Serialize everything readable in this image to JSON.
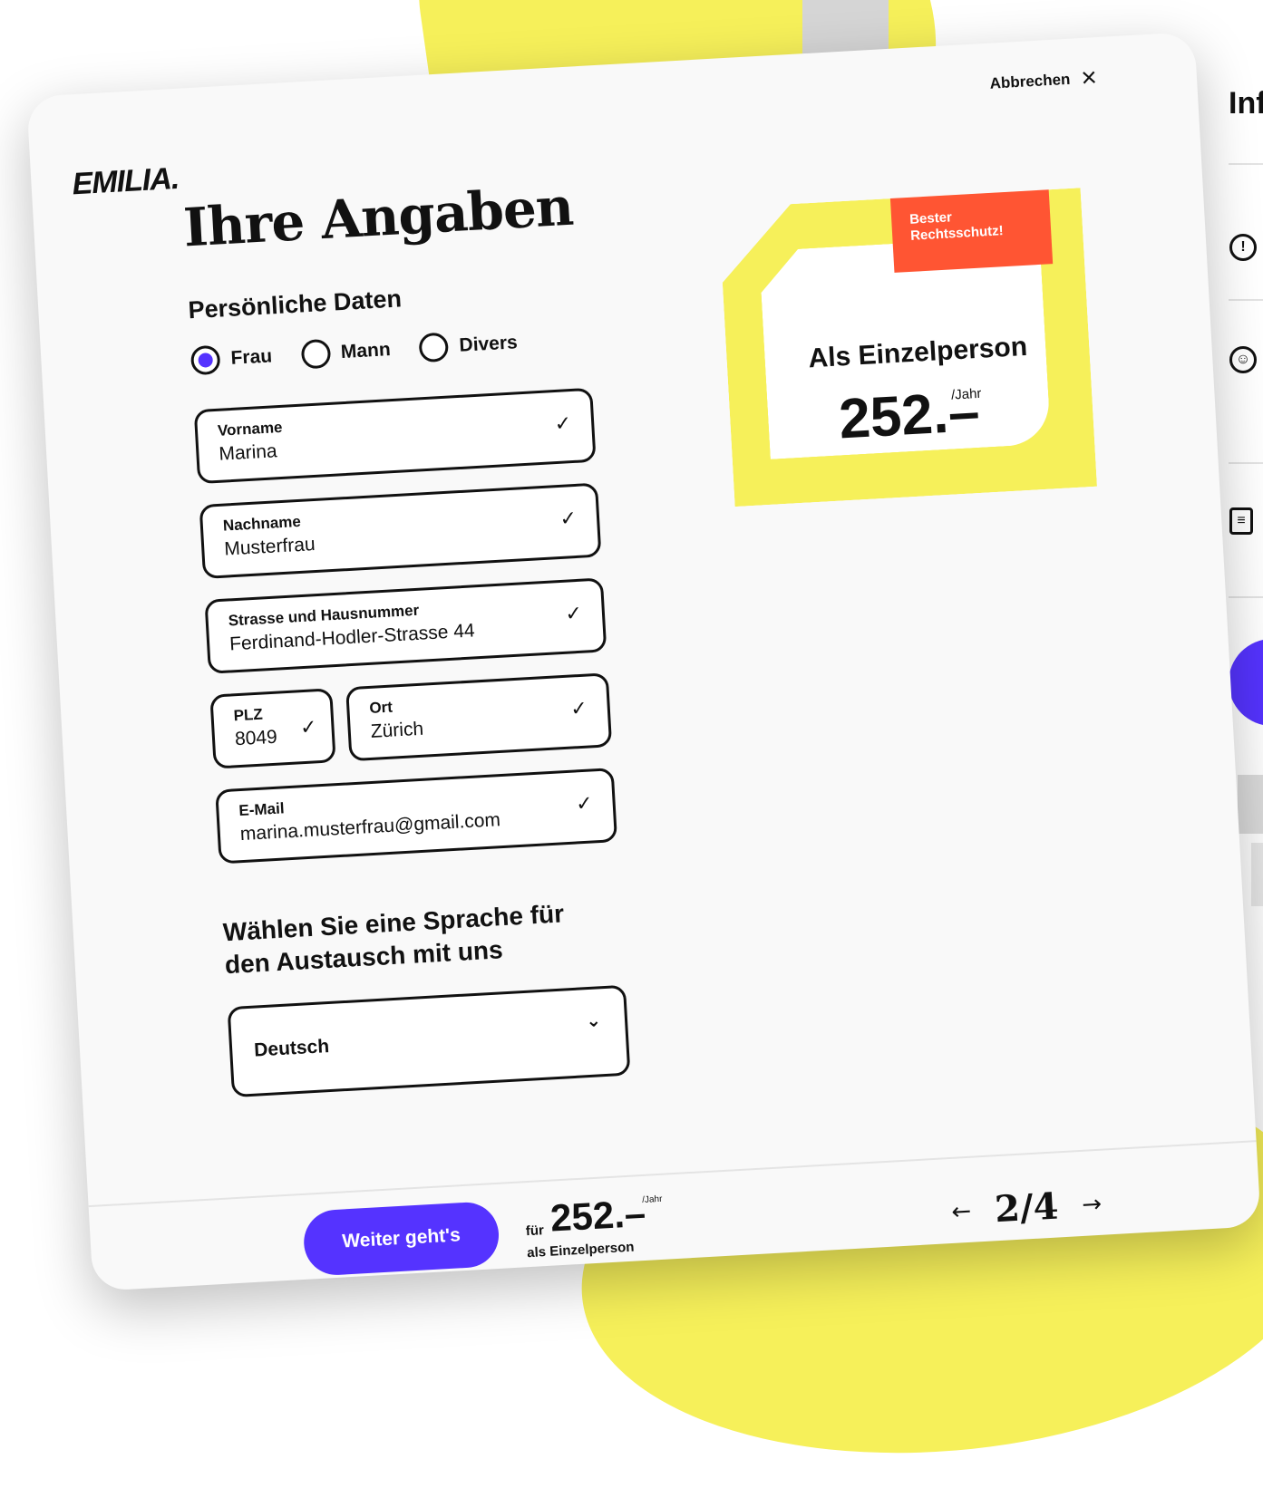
{
  "header": {
    "cancel_label": "Abbrechen",
    "close_icon": "×"
  },
  "brand": {
    "logo": "EMILIA."
  },
  "page": {
    "title": "Ihre Angaben"
  },
  "personal": {
    "section_title": "Persönliche Daten",
    "salutation": {
      "options": [
        {
          "label": "Frau",
          "selected": true
        },
        {
          "label": "Mann",
          "selected": false
        },
        {
          "label": "Divers",
          "selected": false
        }
      ]
    },
    "fields": {
      "first_name": {
        "label": "Vorname",
        "value": "Marina"
      },
      "last_name": {
        "label": "Nachname",
        "value": "Musterfrau"
      },
      "street": {
        "label": "Strasse und Hausnummer",
        "value": "Ferdinand-Hodler-Strasse 44"
      },
      "zip": {
        "label": "PLZ",
        "value": "8049"
      },
      "city": {
        "label": "Ort",
        "value": "Zürich"
      },
      "email": {
        "label": "E-Mail",
        "value": "marina.musterfrau@gmail.com"
      }
    },
    "check_icon": "✓"
  },
  "language": {
    "title": "Wählen Sie eine Sprache für den Austausch mit uns",
    "selected": "Deutsch",
    "chevron": "⌄"
  },
  "price_card": {
    "tag": "Bester Rechtsschutz!",
    "label": "Als Einzelperson",
    "amount": "252.–",
    "unit": "/Jahr"
  },
  "footer": {
    "next_label": "Weiter geht's",
    "fuer": "für",
    "amount": "252.–",
    "unit": "/Jahr",
    "sub": "als Einzelperson",
    "pager": {
      "prev": "←",
      "current": "2/4",
      "next": "→"
    }
  },
  "background_panel": {
    "title": "Inf",
    "icons": [
      "!",
      "☺",
      "≡"
    ]
  },
  "colors": {
    "accent_blue": "#5533ff",
    "yellow": "#f6f05a",
    "tag_red": "#ff5533"
  }
}
